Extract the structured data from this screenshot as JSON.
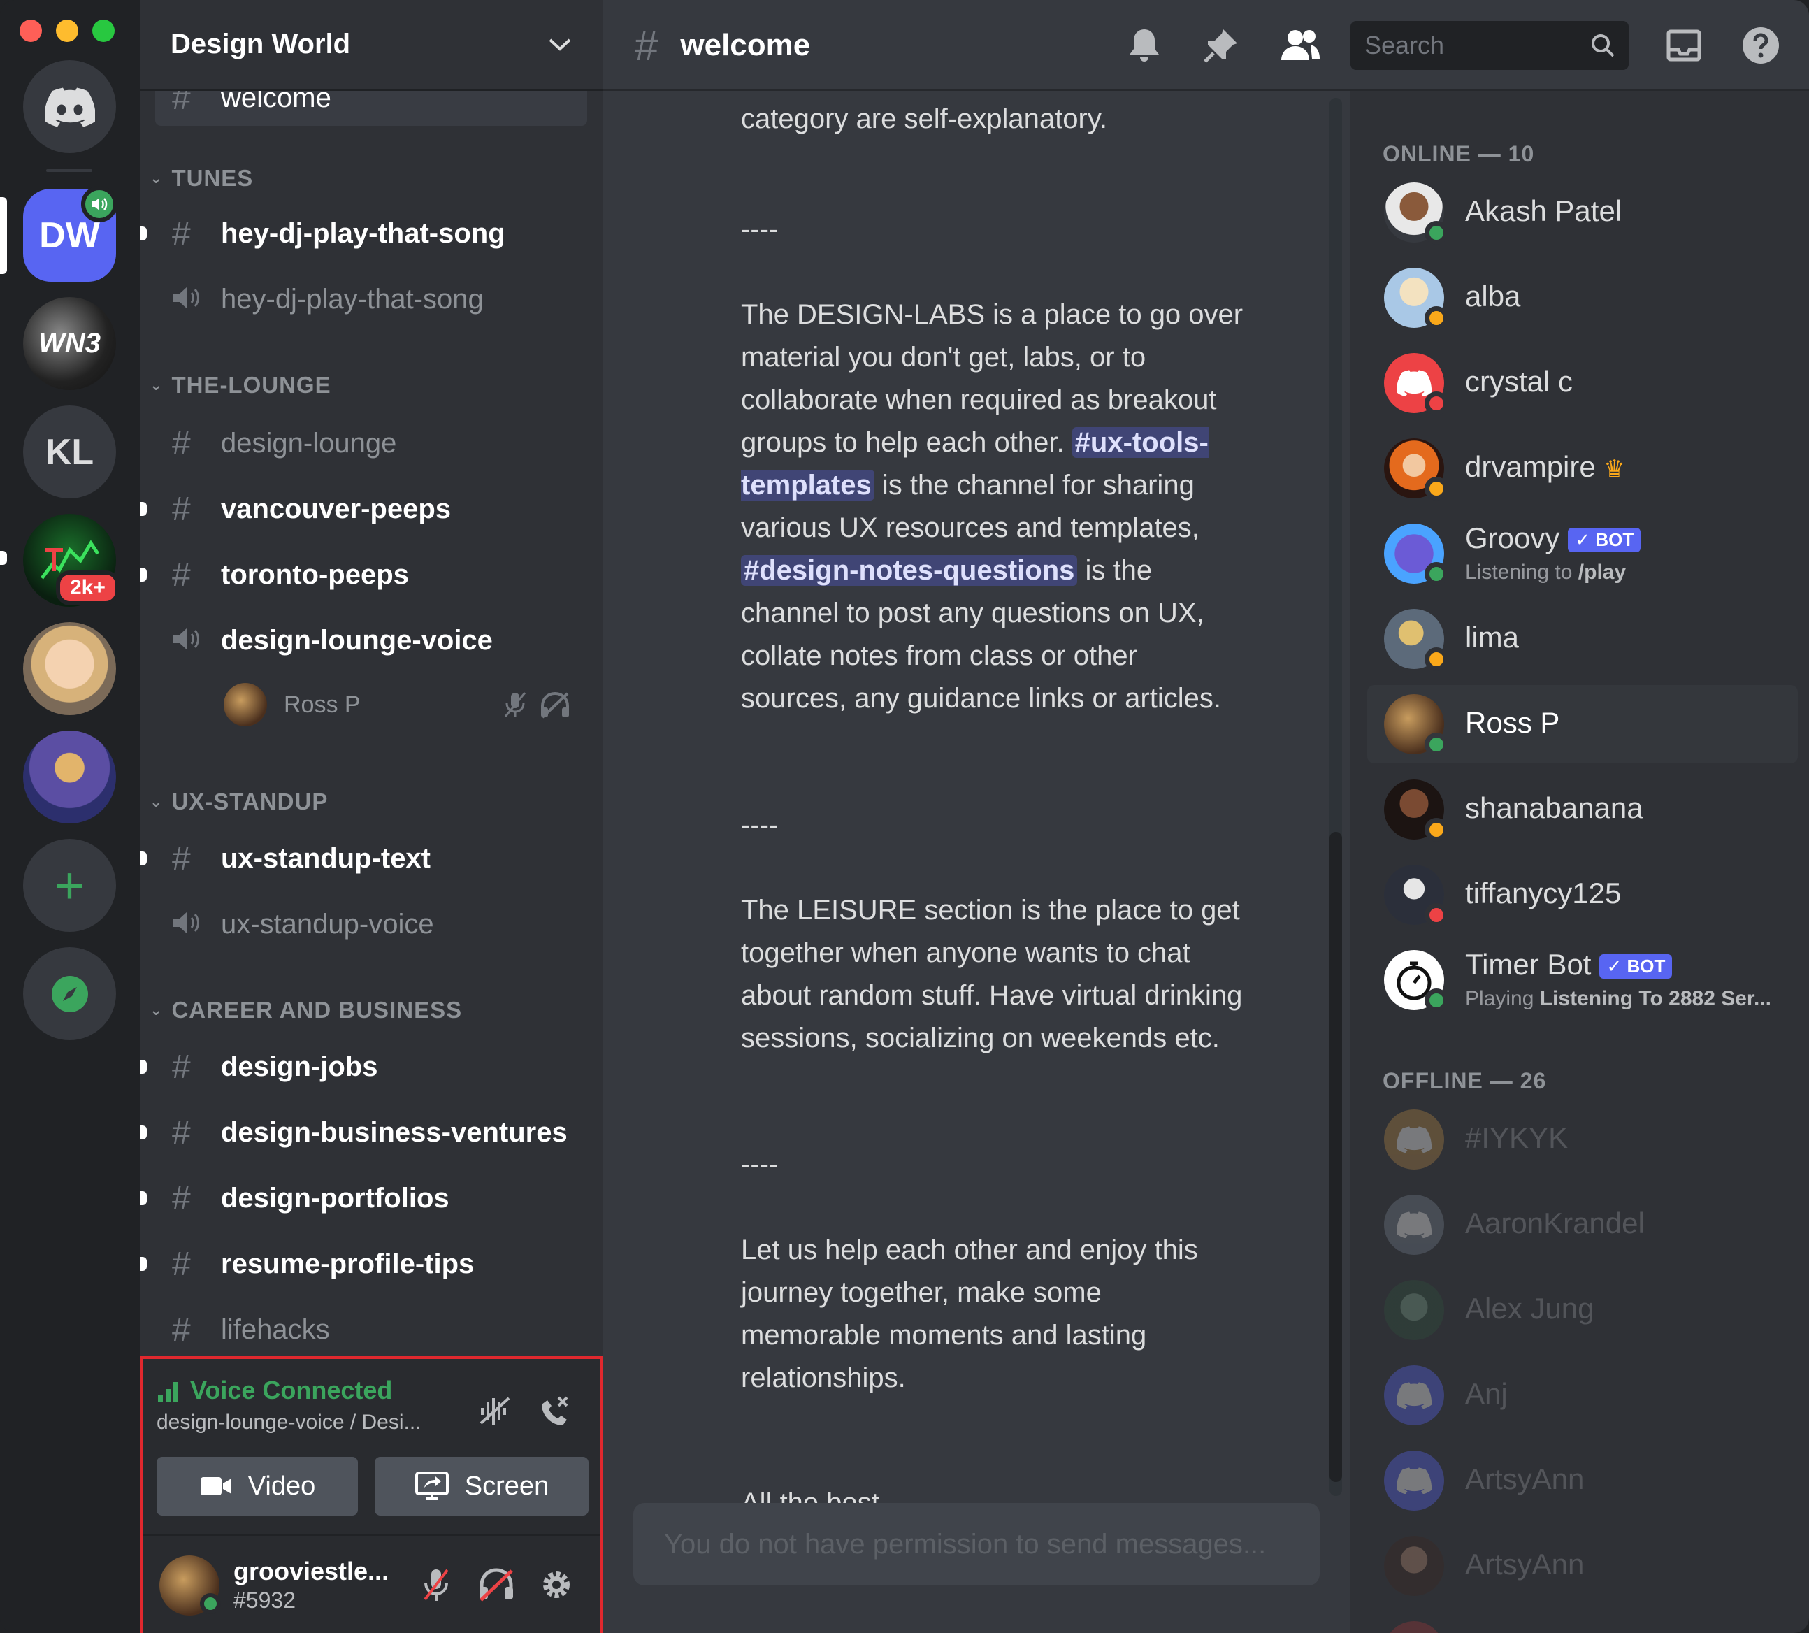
{
  "window": {
    "server_name": "Design World"
  },
  "rail": {
    "servers": [
      {
        "id": "home",
        "label": ""
      },
      {
        "id": "dw",
        "label": "DW"
      },
      {
        "id": "wn3",
        "label": "WN3"
      },
      {
        "id": "kl",
        "label": "KL"
      },
      {
        "id": "td",
        "label": "",
        "badge": "2k+"
      },
      {
        "id": "kid",
        "label": ""
      },
      {
        "id": "cartoon",
        "label": ""
      }
    ],
    "add_label": "+"
  },
  "sidebar": {
    "top_partial_channel": "welcome",
    "categories": [
      {
        "name": "TUNES",
        "channels": [
          {
            "name": "hey-dj-play-that-song",
            "type": "text",
            "unread": true
          },
          {
            "name": "hey-dj-play-that-song",
            "type": "voice",
            "unread": false
          }
        ]
      },
      {
        "name": "THE-LOUNGE",
        "channels": [
          {
            "name": "design-lounge",
            "type": "text",
            "unread": false
          },
          {
            "name": "vancouver-peeps",
            "type": "text",
            "unread": true
          },
          {
            "name": "toronto-peeps",
            "type": "text",
            "unread": true
          },
          {
            "name": "design-lounge-voice",
            "type": "voice",
            "unread": false,
            "bright": true
          }
        ]
      },
      {
        "name": "UX-STANDUP",
        "channels": [
          {
            "name": "ux-standup-text",
            "type": "text",
            "unread": true
          },
          {
            "name": "ux-standup-voice",
            "type": "voice",
            "unread": false
          }
        ]
      },
      {
        "name": "CAREER AND BUSINESS",
        "channels": [
          {
            "name": "design-jobs",
            "type": "text",
            "unread": true
          },
          {
            "name": "design-business-ventures",
            "type": "text",
            "unread": true
          },
          {
            "name": "design-portfolios",
            "type": "text",
            "unread": true
          },
          {
            "name": "resume-profile-tips",
            "type": "text",
            "unread": true
          },
          {
            "name": "lifehacks",
            "type": "text",
            "unread": false
          }
        ]
      }
    ],
    "voice_member": "Ross P"
  },
  "voice_panel": {
    "status": "Voice Connected",
    "location": "design-lounge-voice / Desi...",
    "video_label": "Video",
    "screen_label": "Screen"
  },
  "user": {
    "name": "grooviestle...",
    "tag": "#5932"
  },
  "channel": {
    "name": "welcome"
  },
  "search": {
    "placeholder": "Search"
  },
  "messages": {
    "line0": "category are self-explanatory.",
    "sep1": "----",
    "p1_a": "The DESIGN-LABS is a place to go over material you don't get, labs, or to collaborate when required as breakout groups to help each other.",
    "p1_mention1": "#ux-tools-templates",
    "p1_b": "is the channel for sharing various UX resources and templates,",
    "p1_mention2": "#design-notes-questions",
    "p1_c": "is the channel to post any questions on UX, collate notes from class or other sources, any guidance links or articles.",
    "sep2": "----",
    "p2": "The LEISURE section is the place to get together when anyone wants to chat about random stuff. Have virtual drinking sessions, socializing on weekends etc.",
    "sep3": "----",
    "p3": "Let us help each other and enjoy this journey together, make some memorable moments and lasting relationships.",
    "p4_partial": "All the best"
  },
  "composer": {
    "placeholder": "You do not have permission to send messages..."
  },
  "members": {
    "online_header": "ONLINE — 10",
    "offline_header": "OFFLINE — 26",
    "online": [
      {
        "name": "Akash Patel",
        "status": "online"
      },
      {
        "name": "alba",
        "status": "idle"
      },
      {
        "name": "crystal c",
        "status": "dnd"
      },
      {
        "name": "drvampire",
        "status": "idle",
        "crown": true
      },
      {
        "name": "Groovy",
        "status": "online",
        "bot": "BOT",
        "sub_prefix": "Listening to ",
        "sub_bold": "/play"
      },
      {
        "name": "lima",
        "status": "idle"
      },
      {
        "name": "Ross P",
        "status": "online"
      },
      {
        "name": "shanabanana",
        "status": "idle"
      },
      {
        "name": "tiffanycy125",
        "status": "dnd"
      },
      {
        "name": "Timer Bot",
        "status": "online",
        "bot": "BOT",
        "sub_prefix": "Playing ",
        "sub_bold": "Listening To 2882 Ser..."
      }
    ],
    "offline": [
      {
        "name": "#IYKYK"
      },
      {
        "name": "AaronKrandel"
      },
      {
        "name": "Alex Jung"
      },
      {
        "name": "Anj"
      },
      {
        "name": "ArtsyAnn"
      },
      {
        "name": "ArtsyAnn"
      }
    ]
  },
  "colors": {
    "blurple": "#5865f2",
    "green": "#3ba55d",
    "idle": "#faa81a",
    "dnd": "#ed4245",
    "highlight_border": "#e0282e"
  }
}
